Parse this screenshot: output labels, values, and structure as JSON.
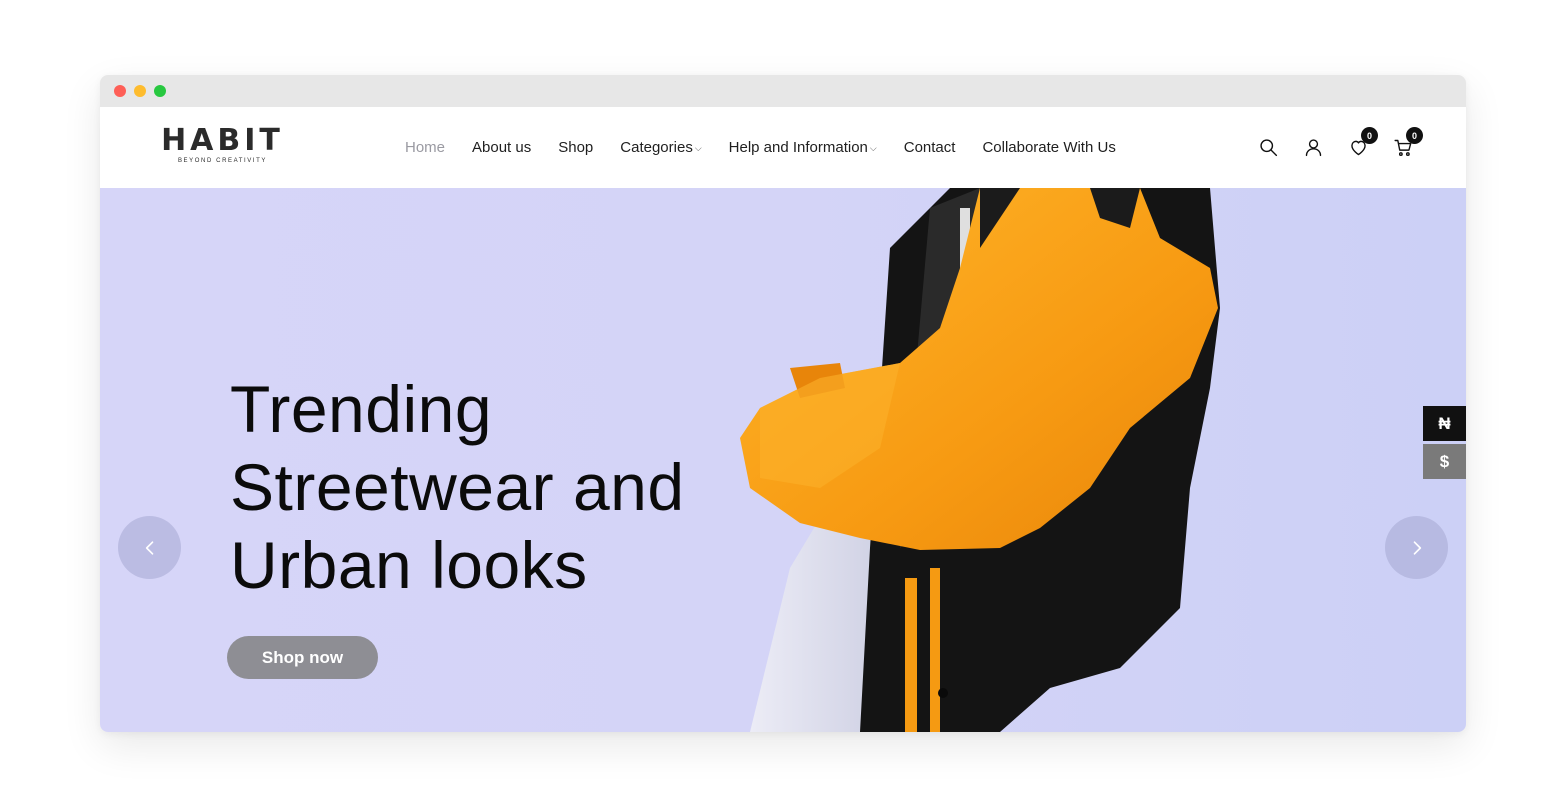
{
  "brand": {
    "name": "HABIT",
    "tagline": "BEYOND CREATIVITY"
  },
  "nav": [
    {
      "label": "Home",
      "active": true
    },
    {
      "label": "About us"
    },
    {
      "label": "Shop"
    },
    {
      "label": "Categories",
      "dropdown": true
    },
    {
      "label": "Help and Information",
      "dropdown": true
    },
    {
      "label": "Contact"
    },
    {
      "label": "Collaborate With Us"
    }
  ],
  "header_icons": {
    "search": "search-icon",
    "account": "user-icon",
    "wishlist": "heart-icon",
    "cart": "cart-icon",
    "wishlist_count": "0",
    "cart_count": "0"
  },
  "hero": {
    "title_line1": "Trending",
    "title_line2": "Streetwear and",
    "title_line3": "Urban looks",
    "cta_label": "Shop now",
    "prev_icon": "chevron-left-icon",
    "next_icon": "chevron-right-icon"
  },
  "currency_switcher": {
    "ngn_symbol": "₦",
    "usd_symbol": "$"
  },
  "colors": {
    "hero_background": "#d6d5f8",
    "jacket_orange": "#f7a21b",
    "active_nav": "#9a9aa2",
    "cta_background": "#8e8e94"
  }
}
